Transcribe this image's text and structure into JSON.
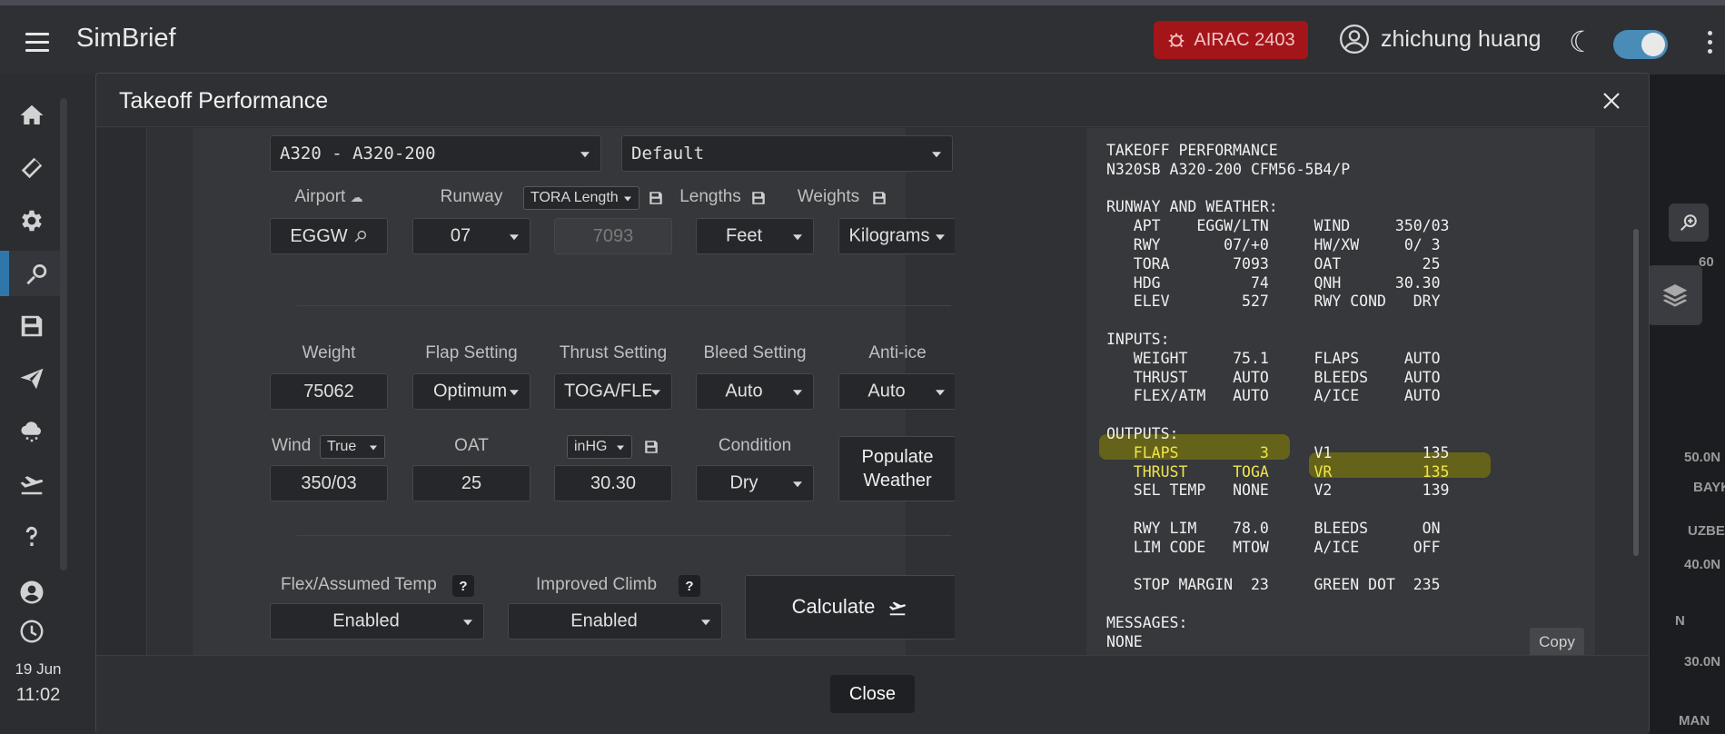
{
  "app": {
    "brand": "SimBrief",
    "airac": "AIRAC 2403",
    "user": "zhichung huang",
    "date": "19 Jun",
    "time": "11:02"
  },
  "map": {
    "labels": [
      "60",
      "50.0N",
      "BAYK",
      "UZBE",
      "40.0N",
      "N",
      "30.0N",
      "MAN"
    ]
  },
  "modal": {
    "title": "Takeoff Performance",
    "close_label": "Close"
  },
  "form": {
    "aircraft": "A320 - A320-200",
    "profile": "Default",
    "labels": {
      "airport": "Airport",
      "runway": "Runway",
      "lengths": "Lengths",
      "weights": "Weights",
      "weight": "Weight",
      "flap": "Flap Setting",
      "thrust": "Thrust Setting",
      "bleed": "Bleed Setting",
      "antiice": "Anti-ice",
      "wind": "Wind",
      "oat": "OAT",
      "condition": "Condition",
      "flex": "Flex/Assumed Temp",
      "climb": "Improved Climb"
    },
    "airport": "EGGW",
    "runway": "07",
    "tora_mode": "TORA Length",
    "tora_value": "7093",
    "lengths_unit": "Feet",
    "weights_unit": "Kilograms",
    "weight": "75062",
    "flap": "Optimum",
    "thrust": "TOGA/FLEX",
    "bleed": "Auto",
    "antiice": "Auto",
    "wind_ref": "True",
    "wind": "350/03",
    "oat": "25",
    "qnh_unit": "inHG",
    "qnh": "30.30",
    "condition": "Dry",
    "populate_label": "Populate Weather",
    "flex": "Enabled",
    "climb": "Enabled",
    "help": "?",
    "calculate_label": "Calculate"
  },
  "output": {
    "lines": [
      "TAKEOFF PERFORMANCE",
      "N320SB A320-200 CFM56-5B4/P",
      "",
      "RUNWAY AND WEATHER:",
      "   APT    EGGW/LTN     WIND     350/03",
      "   RWY       07/+0     HW/XW     0/ 3",
      "   TORA       7093     OAT         25",
      "   HDG          74     QNH      30.30",
      "   ELEV        527     RWY COND   DRY",
      "",
      "INPUTS:",
      "   WEIGHT     75.1     FLAPS     AUTO",
      "   THRUST     AUTO     BLEEDS    AUTO",
      "   FLEX/ATM   AUTO     A/ICE     AUTO",
      "",
      "OUTPUTS:"
    ],
    "out_flaps": "   FLAPS         3",
    "out_v1": "     V1          135",
    "out_thrust": "   THRUST     TOGA",
    "out_vr": "     VR          135",
    "out_sel": "   SEL TEMP   NONE     V2          139",
    "lines2": [
      "",
      "   RWY LIM    78.0     BLEEDS      ON",
      "   LIM CODE   MTOW     A/ICE      OFF",
      "",
      "   STOP MARGIN  23     GREEN DOT  235",
      "",
      "MESSAGES:",
      "NONE"
    ],
    "copy_label": "Copy"
  },
  "colors": {
    "accent": "#2f77a8",
    "airac_bg": "#a4151a",
    "highlight_text": "#f0e64a",
    "highlight_marker": "#75720d"
  }
}
